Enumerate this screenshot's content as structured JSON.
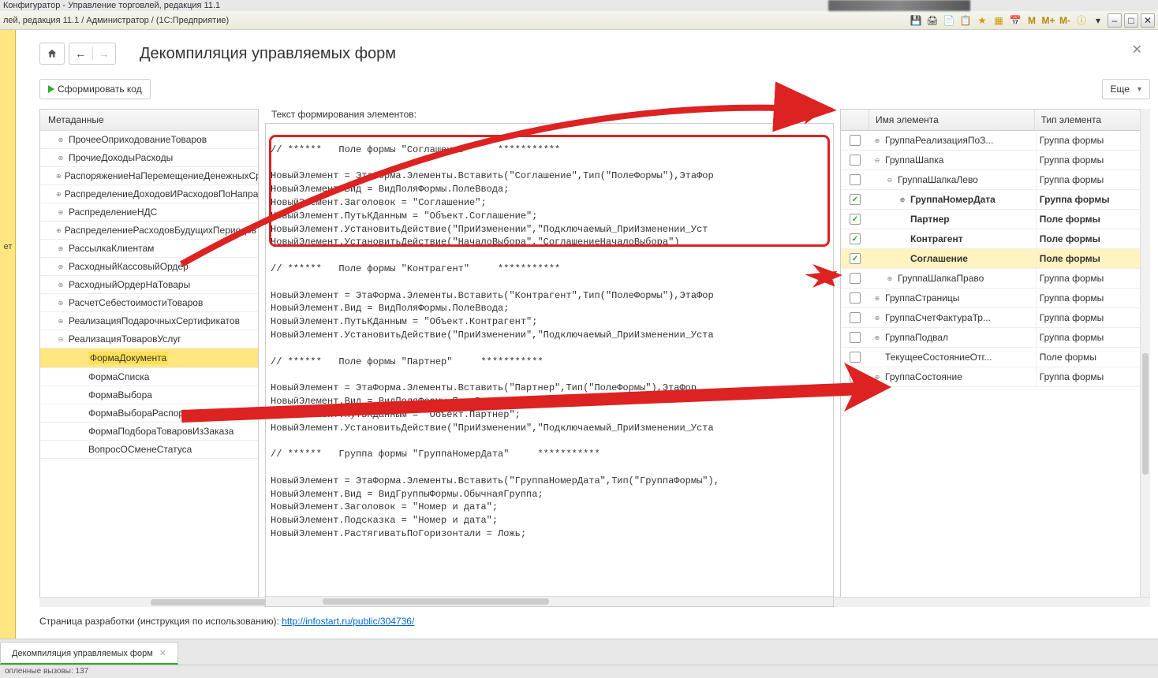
{
  "window": {
    "top_title": "Конфигуратор - Управление торговлей, редакция 11.1",
    "title": "лей, редакция 11.1 / Администратор / (1С:Предприятие)"
  },
  "page": {
    "title": "Декомпиляция управляемых форм"
  },
  "toolbar": {
    "generate": "Сформировать код",
    "more": "Еще"
  },
  "left_panel": {
    "header": "Метаданные",
    "items": [
      {
        "lvl": 1,
        "exp": "⊕",
        "label": "ПрочееОприходованиеТоваров"
      },
      {
        "lvl": 1,
        "exp": "⊕",
        "label": "ПрочиеДоходыРасходы"
      },
      {
        "lvl": 1,
        "exp": "⊕",
        "label": "РаспоряжениеНаПеремещениеДенежныхСредств"
      },
      {
        "lvl": 1,
        "exp": "⊕",
        "label": "РаспределениеДоходовИРасходовПоНаправлениямДеятельности"
      },
      {
        "lvl": 1,
        "exp": "⊕",
        "label": "РаспределениеНДС"
      },
      {
        "lvl": 1,
        "exp": "⊕",
        "label": "РаспределениеРасходовБудущихПериодов"
      },
      {
        "lvl": 1,
        "exp": "⊕",
        "label": "РассылкаКлиентам"
      },
      {
        "lvl": 1,
        "exp": "⊕",
        "label": "РасходныйКассовыйОрдер"
      },
      {
        "lvl": 1,
        "exp": "⊕",
        "label": "РасходныйОрдерНаТовары"
      },
      {
        "lvl": 1,
        "exp": "⊕",
        "label": "РасчетСебестоимостиТоваров"
      },
      {
        "lvl": 1,
        "exp": "⊕",
        "label": "РеализацияПодарочныхСертификатов"
      },
      {
        "lvl": 1,
        "exp": "⊖",
        "label": "РеализацияТоваровУслуг"
      },
      {
        "lvl": 2,
        "exp": "",
        "label": "ФормаДокумента",
        "sel": true
      },
      {
        "lvl": 2,
        "exp": "",
        "label": "ФормаСписка"
      },
      {
        "lvl": 2,
        "exp": "",
        "label": "ФормаВыбора"
      },
      {
        "lvl": 2,
        "exp": "",
        "label": "ФормаВыбораРаспоряжения"
      },
      {
        "lvl": 2,
        "exp": "",
        "label": "ФормаПодбораТоваровИзЗаказа"
      },
      {
        "lvl": 2,
        "exp": "",
        "label": "ВопросОСменеСтатуса"
      }
    ]
  },
  "code": {
    "label": "Текст формирования элементов:",
    "text": "\n// ******   Поле формы \"Соглашение\"     ***********\n\nНовыйЭлемент = ЭтаФорма.Элементы.Вставить(\"Соглашение\",Тип(\"ПолеФормы\"),ЭтаФор\nНовыйЭлемент.Вид = ВидПоляФормы.ПолеВвода;\nНовыйЭлемент.Заголовок = \"Соглашение\";\nНовыйЭлемент.ПутьКДанным = \"Объект.Соглашение\";\nНовыйЭлемент.УстановитьДействие(\"ПриИзменении\",\"Подключаемый_ПриИзменении_Уст\nНовыйЭлемент.УстановитьДействие(\"НачалоВыбора\",\"СоглашениеНачалоВыбора\")\n\n// ******   Поле формы \"Контрагент\"     ***********\n\nНовыйЭлемент = ЭтаФорма.Элементы.Вставить(\"Контрагент\",Тип(\"ПолеФормы\"),ЭтаФор\nНовыйЭлемент.Вид = ВидПоляФормы.ПолеВвода;\nНовыйЭлемент.ПутьКДанным = \"Объект.Контрагент\";\nНовыйЭлемент.УстановитьДействие(\"ПриИзменении\",\"Подключаемый_ПриИзменении_Уста\n\n// ******   Поле формы \"Партнер\"     ***********\n\nНовыйЭлемент = ЭтаФорма.Элементы.Вставить(\"Партнер\",Тип(\"ПолеФормы\"),ЭтаФор\nНовыйЭлемент.Вид = ВидПоляФормы.ПолеВвода;\nНовыйЭлемент.ПутьКДанным = \"Объект.Партнер\";\nНовыйЭлемент.УстановитьДействие(\"ПриИзменении\",\"Подключаемый_ПриИзменении_Уста\n\n// ******   Группа формы \"ГруппаНомерДата\"     ***********\n\nНовыйЭлемент = ЭтаФорма.Элементы.Вставить(\"ГруппаНомерДата\",Тип(\"ГруппаФормы\"),\nНовыйЭлемент.Вид = ВидГруппыФормы.ОбычнаяГруппа;\nНовыйЭлемент.Заголовок = \"Номер и дата\";\nНовыйЭлемент.Подсказка = \"Номер и дата\";\nНовыйЭлемент.РастягиватьПоГоризонтали = Ложь;"
  },
  "right_panel": {
    "col_name": "Имя элемента",
    "col_type": "Тип элемента",
    "rows": [
      {
        "chk": false,
        "ind": 0,
        "exp": "⊕",
        "name": "ГруппаРеализацияПоЗ...",
        "type": "Группа формы"
      },
      {
        "chk": false,
        "ind": 0,
        "exp": "⊖",
        "name": "ГруппаШапка",
        "type": "Группа формы"
      },
      {
        "chk": false,
        "ind": 1,
        "exp": "⊖",
        "name": "ГруппаШапкаЛево",
        "type": "Группа формы"
      },
      {
        "chk": true,
        "bold": true,
        "ind": 2,
        "exp": "⊕",
        "name": "ГруппаНомерДата",
        "type": "Группа формы"
      },
      {
        "chk": true,
        "bold": true,
        "ind": 2,
        "exp": "",
        "name": "Партнер",
        "type": "Поле формы"
      },
      {
        "chk": true,
        "bold": true,
        "ind": 2,
        "exp": "",
        "name": "Контрагент",
        "type": "Поле формы"
      },
      {
        "chk": true,
        "sel": true,
        "bold": true,
        "ind": 2,
        "exp": "",
        "name": "Соглашение",
        "type": "Поле формы"
      },
      {
        "chk": false,
        "ind": 1,
        "exp": "⊕",
        "name": "ГруппаШапкаПраво",
        "type": "Группа формы"
      },
      {
        "chk": false,
        "ind": 0,
        "exp": "⊕",
        "name": "ГруппаСтраницы",
        "type": "Группа формы"
      },
      {
        "chk": false,
        "ind": 0,
        "exp": "⊕",
        "name": "ГруппаСчетФактураТр...",
        "type": "Группа формы"
      },
      {
        "chk": false,
        "ind": 0,
        "exp": "⊕",
        "name": "ГруппаПодвал",
        "type": "Группа формы"
      },
      {
        "chk": false,
        "ind": 0,
        "exp": "",
        "name": "ТекущееСостояниеОтг...",
        "type": "Поле формы"
      },
      {
        "chk": false,
        "ind": 0,
        "exp": "⊕",
        "name": "ГруппаСостояние",
        "type": "Группа формы"
      }
    ]
  },
  "footer": {
    "text": "Страница разработки (инструкция по использованию):  ",
    "link": "http://infostart.ru/public/304736/"
  },
  "tab": {
    "label": "Декомпиляция управляемых форм"
  },
  "status": {
    "text": "опленные вызовы: 137"
  },
  "titlebar_icons": {
    "m": "M",
    "mplus": "M+",
    "mminus": "M-"
  },
  "left_strip": "ет"
}
